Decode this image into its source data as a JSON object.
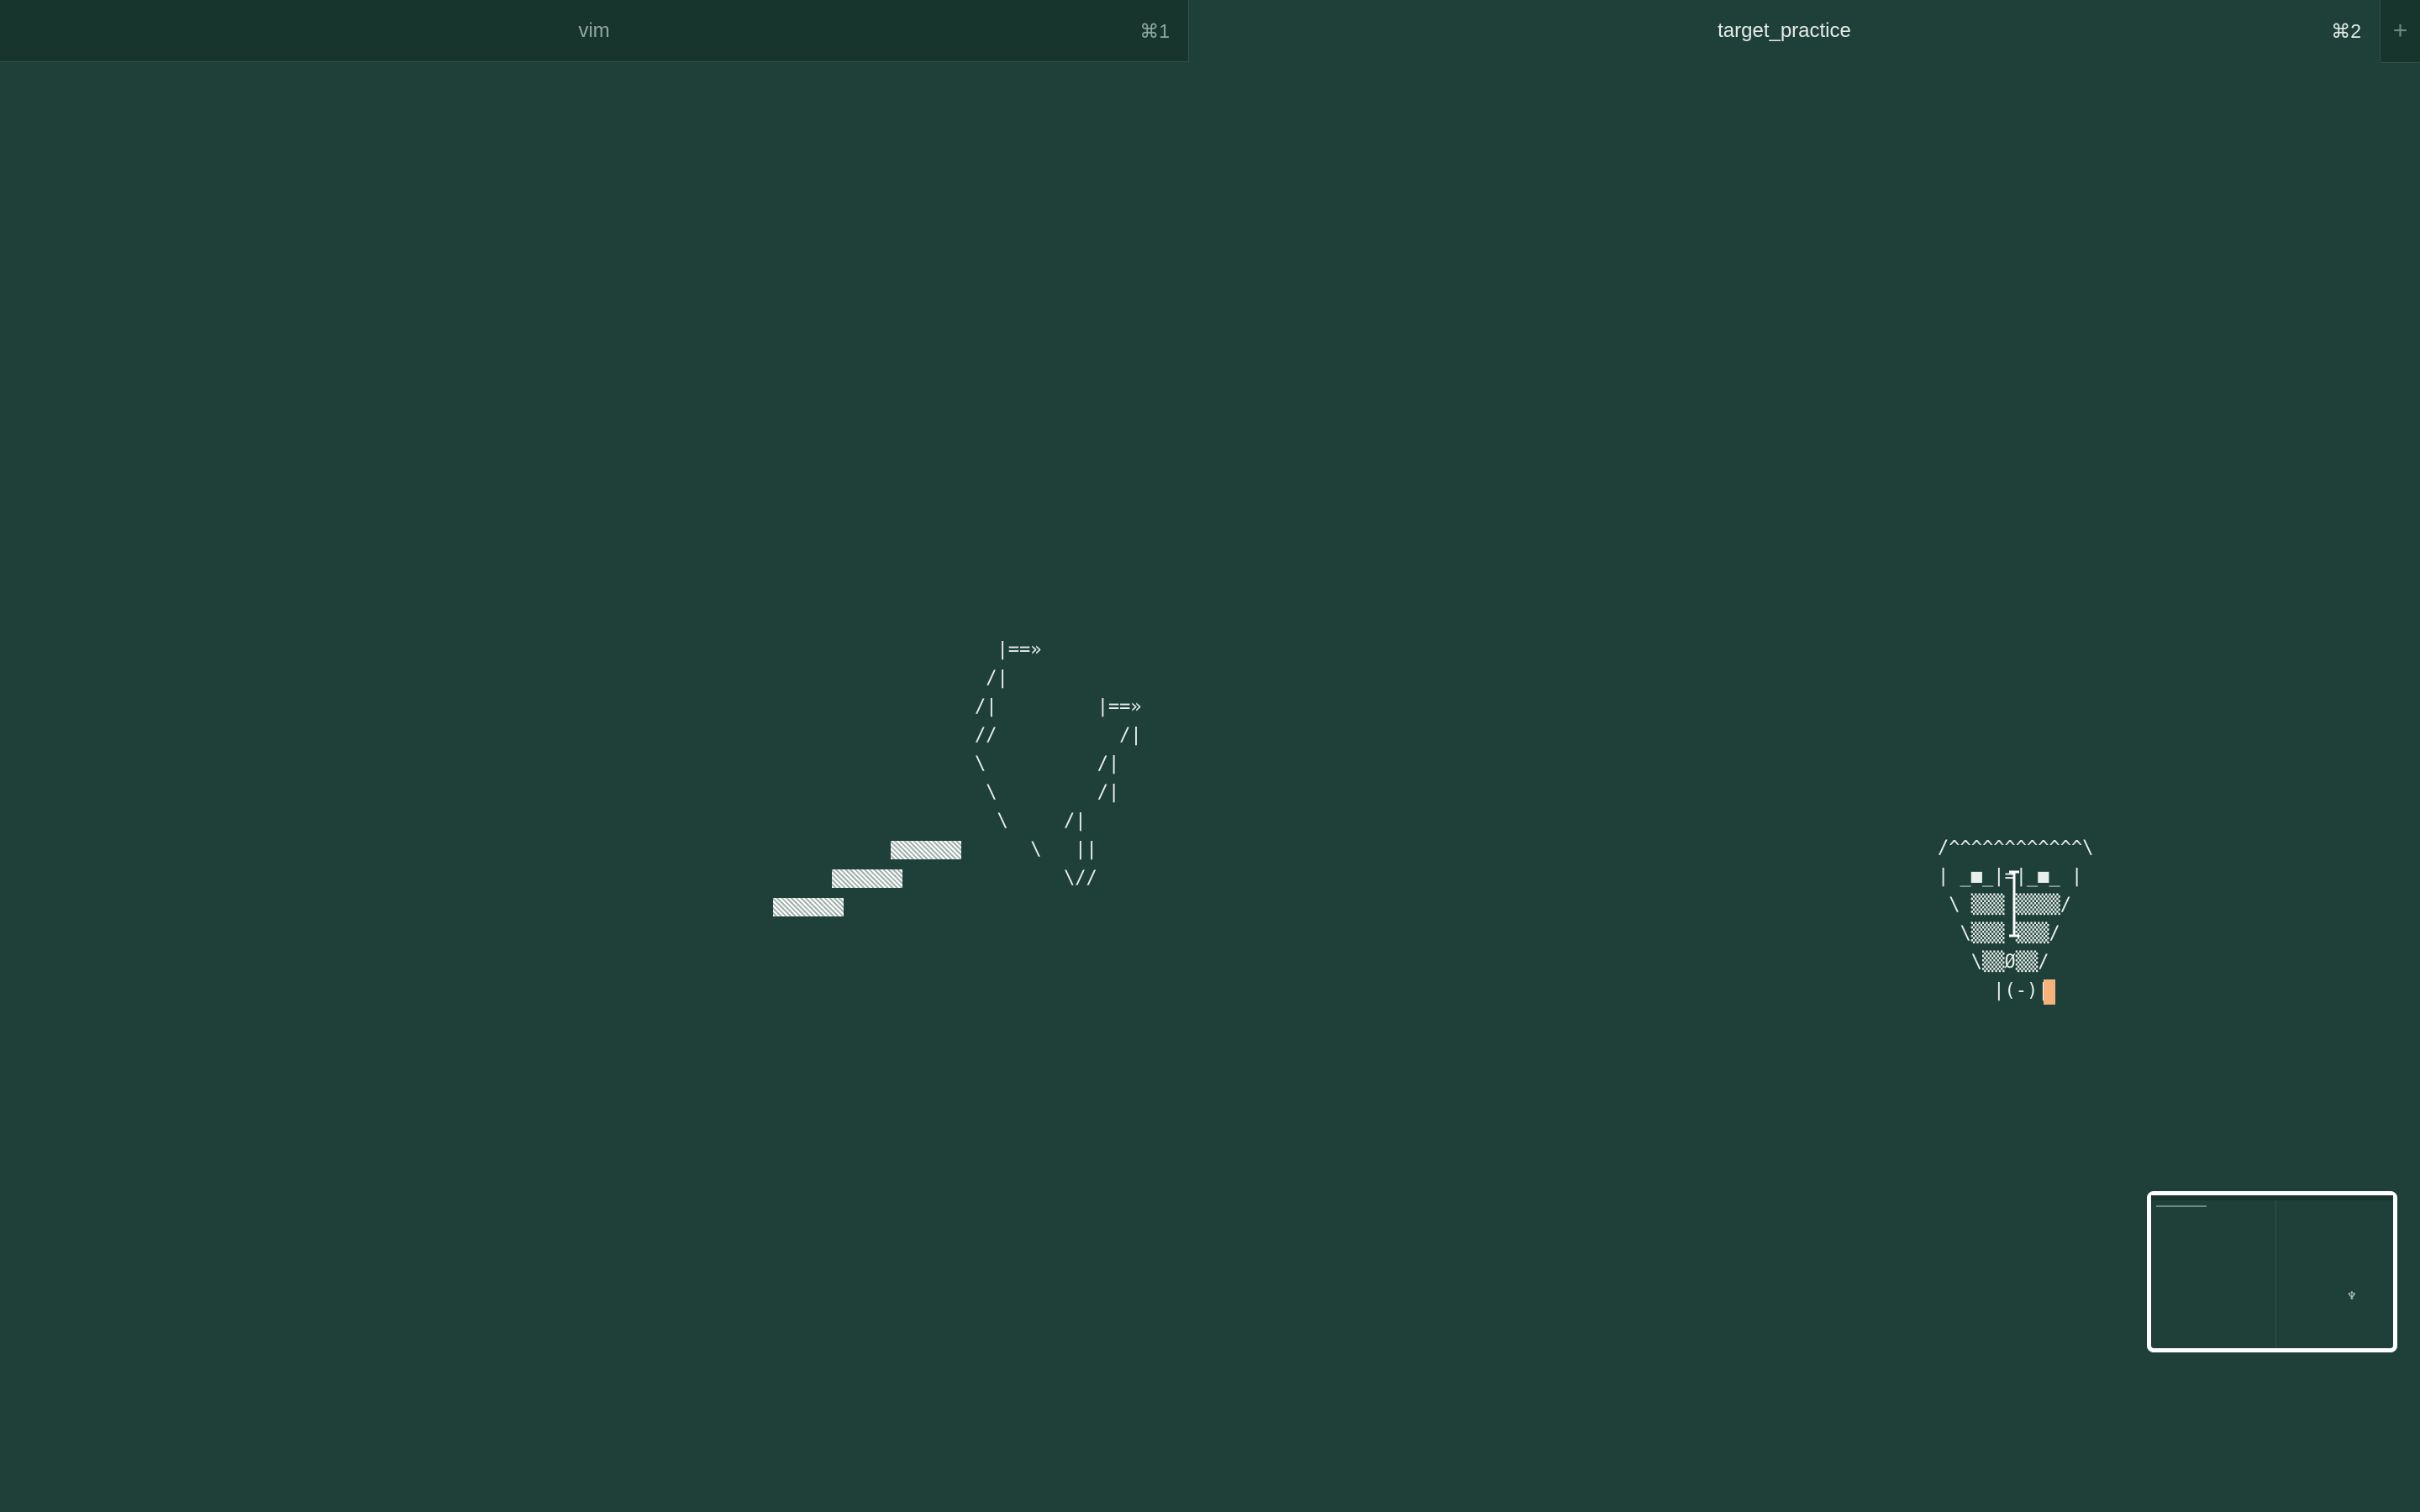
{
  "tabs": [
    {
      "label": "vim",
      "shortcut": "⌘1",
      "active": false
    },
    {
      "label": "target_practice",
      "shortcut": "⌘2",
      "active": true
    }
  ],
  "new_tab_label": "+",
  "art": {
    "archer": "  |==»\n /|\n/|         |==»\n//           /|\n\\          /|\n \\         /|\n  \\     /|\n     \\   ||\n        \\//",
    "target": "/^^^^^^^^^^^^\\\n| _■_|=|_■_ |\n \\ ▒▒▒ ▒▒▒▒/\n  \\▒▒▒ ▒▒▒/\n   \\▒▒Ø▒▒/\n     |(-)|"
  },
  "colors": {
    "background": "#1f4038",
    "tab_inactive": "#17352d",
    "text": "#e9efec",
    "cursor": "#f5b27a"
  }
}
